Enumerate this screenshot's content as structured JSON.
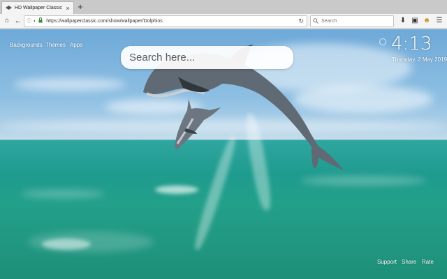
{
  "browser": {
    "tab": {
      "title": "HD Wallpaper Classic - Dolp",
      "close": "×",
      "favicon": "wallpaper-icon"
    },
    "new_tab": "+",
    "url": "https://wallpaperclassic.com/show/wallpaper/Dolphins",
    "search_placeholder": "Search",
    "icons": {
      "home": "⌂",
      "back": "←",
      "info": "ⓘ",
      "shield": "◐",
      "lock": "🔒",
      "reload": "↻",
      "search": "🔍",
      "download": "⬇",
      "sidebar": "▣",
      "extension": "☻",
      "menu": "☰"
    }
  },
  "page": {
    "nav_links": [
      "Backgrounds",
      "Themes",
      "Apps"
    ],
    "search_placeholder": "Search here...",
    "clock": {
      "time": "4:13",
      "date": "Thursday, 2 May 2019"
    },
    "footer_links": [
      "Support",
      "Share",
      "Rate"
    ]
  },
  "colors": {
    "sky": "#8fc0e3",
    "sea": "#1f9b8e",
    "dolphin": "#5f6a74",
    "text_on_image": "#ffffff"
  }
}
